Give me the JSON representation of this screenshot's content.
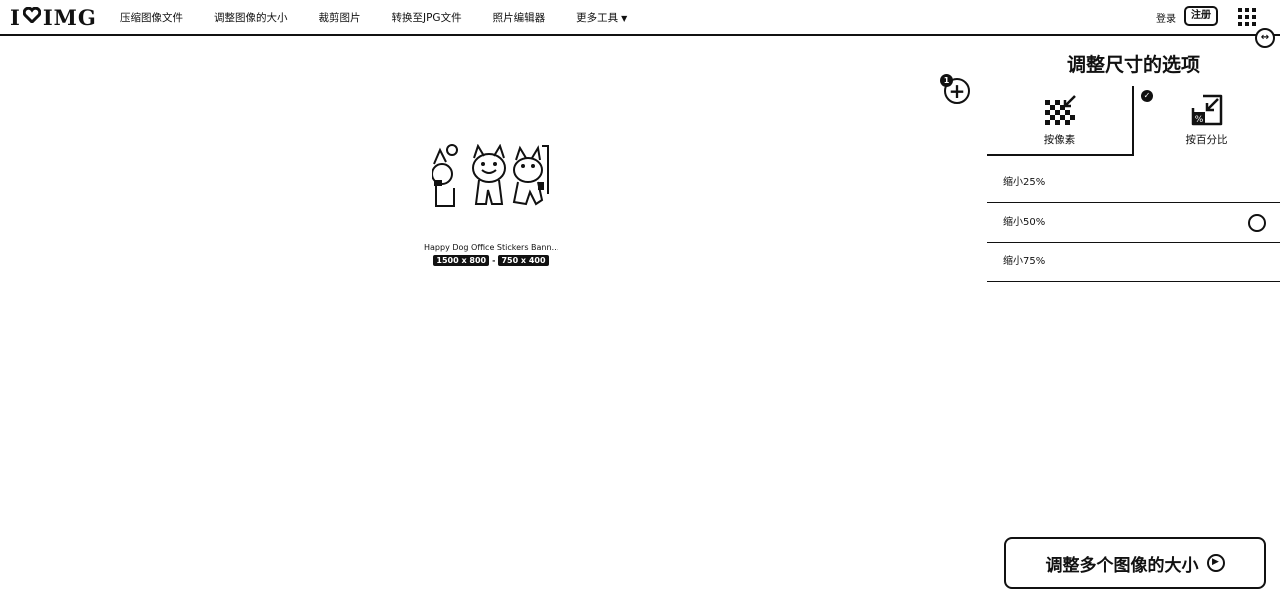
{
  "header": {
    "logo_left": "I",
    "logo_right": "IMG",
    "nav": [
      {
        "label": "压缩图像文件"
      },
      {
        "label": "调整图像的大小"
      },
      {
        "label": "裁剪图片"
      },
      {
        "label": "转换至JPG文件"
      },
      {
        "label": "照片编辑器"
      },
      {
        "label": "更多工具"
      }
    ],
    "login": "登录",
    "register": "注册"
  },
  "canvas": {
    "file_count": "1",
    "add_symbol": "+",
    "file": {
      "name": "Happy Dog Office Stickers Bann…",
      "original_dims": "1500 x 800",
      "separator": "-",
      "new_dims": "750 x 400"
    }
  },
  "sidebar": {
    "title": "调整尺寸的选项",
    "tabs": [
      {
        "label": "按像素"
      },
      {
        "label": "按百分比"
      }
    ],
    "options": [
      {
        "label": "缩小25%"
      },
      {
        "label": "缩小50%"
      },
      {
        "label": "缩小75%"
      }
    ],
    "submit": "调整多个图像的大小"
  }
}
